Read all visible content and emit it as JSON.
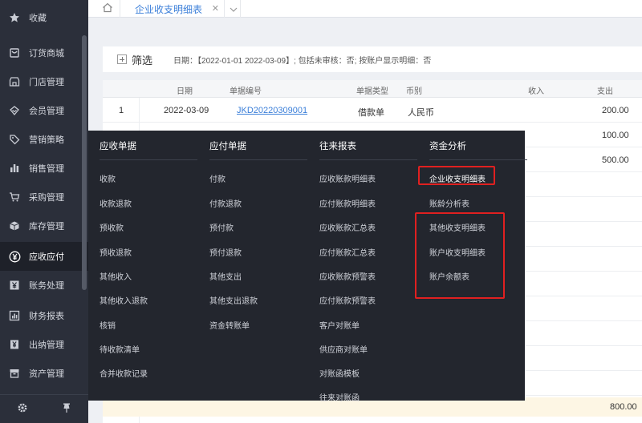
{
  "sidebar": {
    "items": [
      {
        "label": "收藏",
        "icon": "star-icon"
      },
      {
        "label": "订货商城",
        "icon": "store-cart-icon"
      },
      {
        "label": "门店管理",
        "icon": "shop-icon"
      },
      {
        "label": "会员管理",
        "icon": "member-icon"
      },
      {
        "label": "营销策略",
        "icon": "tag-icon"
      },
      {
        "label": "销售管理",
        "icon": "bar-chart-icon"
      },
      {
        "label": "采购管理",
        "icon": "cart-icon"
      },
      {
        "label": "库存管理",
        "icon": "box-icon"
      },
      {
        "label": "应收应付",
        "icon": "yen-circle-icon"
      },
      {
        "label": "账务处理",
        "icon": "yen-box-icon"
      },
      {
        "label": "财务报表",
        "icon": "report-icon"
      },
      {
        "label": "出纳管理",
        "icon": "yen-doc-icon"
      },
      {
        "label": "资产管理",
        "icon": "asset-icon"
      }
    ],
    "active_index": 8
  },
  "tabs": {
    "active_label": "企业收支明细表"
  },
  "filter": {
    "label": "筛选",
    "conditions": "日期：【2022-01-01 2022-03-09】; 包括未审核：否; 按账户显示明细：否"
  },
  "table": {
    "columns": [
      "日期",
      "单据编号",
      "单据类型",
      "币别",
      "收入",
      "支出"
    ],
    "rows": [
      {
        "num": "1",
        "date": "2022-03-09",
        "doc": "JKD20220309001",
        "type": "借款单",
        "currency": "人民币",
        "income": "",
        "expense": "200.00"
      }
    ],
    "partial_expenses": [
      "100.00",
      "500.00"
    ],
    "total_expense": "800.00"
  },
  "mega_menu": {
    "columns": [
      {
        "head": "应收单据",
        "items": [
          "收款",
          "收款退款",
          "预收款",
          "预收退款",
          "其他收入",
          "其他收入退款",
          "核销",
          "待收款清单",
          "合并收款记录"
        ]
      },
      {
        "head": "应付单据",
        "items": [
          "付款",
          "付款退款",
          "预付款",
          "预付退款",
          "其他支出",
          "其他支出退款",
          "资金转账单"
        ]
      },
      {
        "head": "往来报表",
        "items": [
          "应收账款明细表",
          "应付账款明细表",
          "应收账款汇总表",
          "应付账款汇总表",
          "应收账款预警表",
          "应付账款预警表",
          "客户对账单",
          "供应商对账单",
          "对账函模板",
          "往来对账函"
        ]
      },
      {
        "head": "资金分析",
        "items": [
          "企业收支明细表",
          "账龄分析表",
          "其他收支明细表",
          "账户收支明细表",
          "账户余额表"
        ]
      }
    ]
  },
  "colors": {
    "sidebar_bg": "#2b2f3a",
    "menu_bg": "#23262e",
    "accent": "#3b7fd9",
    "highlight_box": "#e02020"
  }
}
